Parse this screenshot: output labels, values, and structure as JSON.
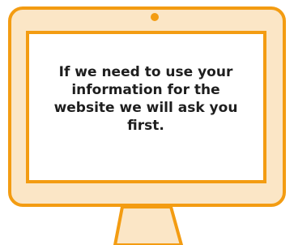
{
  "screen": {
    "message": "If we need to use your information for the website we will ask you first."
  },
  "colors": {
    "outline": "#f39c12",
    "frame_fill": "#fbe6c6",
    "screen_fill": "#ffffff",
    "text": "#1e1e1e"
  },
  "icons": {
    "device": "desktop-monitor-icon",
    "camera": "webcam-dot-icon"
  }
}
